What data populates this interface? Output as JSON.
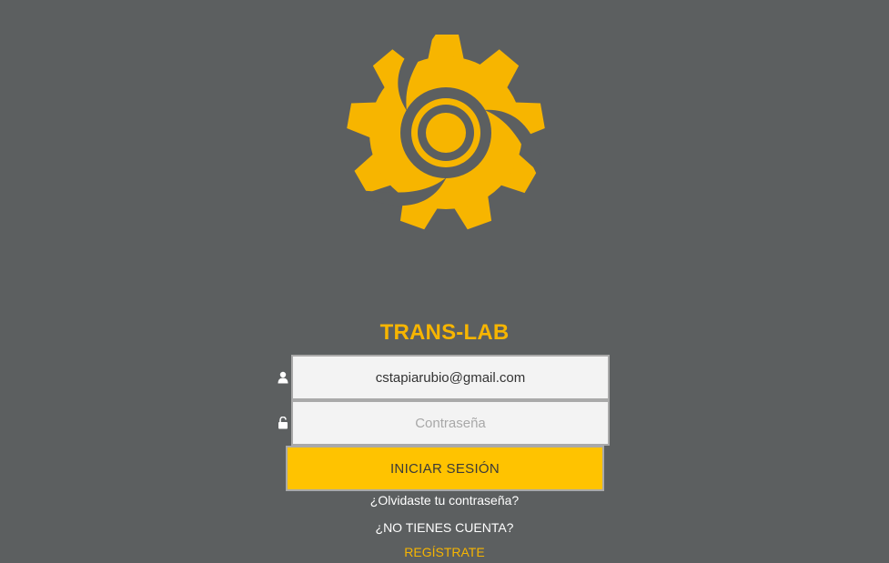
{
  "brand": {
    "title": "TRANS-LAB",
    "accent_color": "#f7b500",
    "logo_icon": "gear-logo-icon"
  },
  "login": {
    "email_value": "cstapiarubio@gmail.com",
    "email_icon": "user-icon",
    "password_placeholder": "Contraseña",
    "password_icon": "lock-icon",
    "submit_label": "INICIAR SESIÓN",
    "forgot_label": "¿Olvidaste tu contraseña?",
    "no_account_label": "¿NO TIENES CUENTA?",
    "register_label": "REGÍSTRATE"
  },
  "colors": {
    "background": "#5c5f60",
    "button": "#ffc300"
  }
}
